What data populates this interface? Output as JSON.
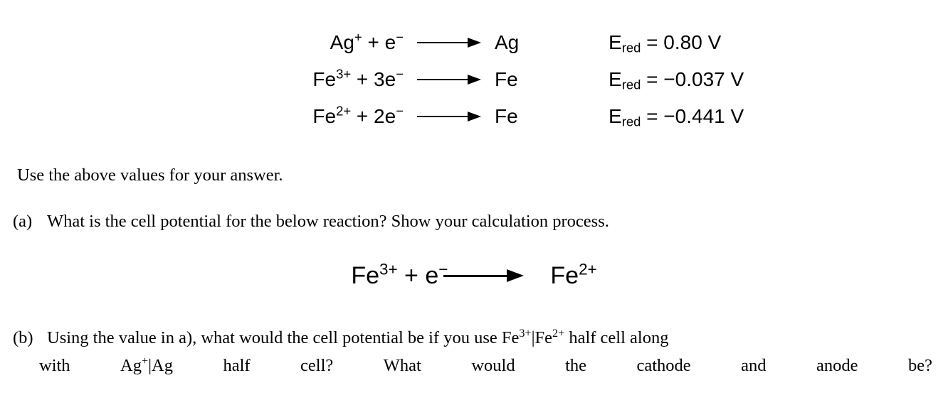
{
  "reduction_table": {
    "rows": [
      {
        "reactants": "Ag+ + e−",
        "reactant_species": "Ag",
        "reactant_charge": "+",
        "electrons": "e",
        "electron_coefficient": "",
        "electron_charge": "−",
        "arrow": "right-arrow",
        "product": "Ag",
        "potential_symbol": "E",
        "potential_subscript": "red",
        "potential_value": "= 0.80 V"
      },
      {
        "reactants": "Fe3+ + 3e−",
        "reactant_species": "Fe",
        "reactant_charge": "3+",
        "electrons": "e",
        "electron_coefficient": "3",
        "electron_charge": "−",
        "arrow": "right-arrow",
        "product": "Fe",
        "potential_symbol": "E",
        "potential_subscript": "red",
        "potential_value": "= −0.037 V"
      },
      {
        "reactants": "Fe2+ + 2e−",
        "reactant_species": "Fe",
        "reactant_charge": "2+",
        "electrons": "e",
        "electron_coefficient": "2",
        "electron_charge": "−",
        "arrow": "right-arrow",
        "product": "Fe",
        "potential_symbol": "E",
        "potential_subscript": "red",
        "potential_value": "= −0.441 V"
      }
    ]
  },
  "instruction": "Use the above values for your answer.",
  "questions": {
    "a": {
      "marker": "(a)",
      "text": "What is the cell potential for the below reaction? Show your calculation process.",
      "equation": {
        "left_species": "Fe",
        "left_charge": "3+",
        "plus": "+",
        "electron": "e",
        "electron_charge": "−",
        "arrow": "right-arrow",
        "right_species": "Fe",
        "right_charge": "2+"
      }
    },
    "b": {
      "marker": "(b)",
      "line1_part1": "Using the value in a), what would the cell potential be if you use Fe",
      "line1_charge1": "3+",
      "line1_sep": "|Fe",
      "line1_charge2": "2+",
      "line1_part2": " half cell along",
      "line2_words": [
        "with",
        "Ag+|Ag",
        "half",
        "cell?",
        "What",
        "would",
        "the",
        "cathode",
        "and",
        "anode",
        "be?"
      ],
      "line2_w0": "with",
      "line2_w1_species": "Ag",
      "line2_w1_charge": "+",
      "line2_w1_rest": "|Ag",
      "line2_w2": "half",
      "line2_w3": "cell?",
      "line2_w4": "What",
      "line2_w5": "would",
      "line2_w6": "the",
      "line2_w7": "cathode",
      "line2_w8": "and",
      "line2_w9": "anode",
      "line2_w10": "be?"
    }
  },
  "colors": {
    "background": "#ffffff",
    "text": "#000000"
  }
}
